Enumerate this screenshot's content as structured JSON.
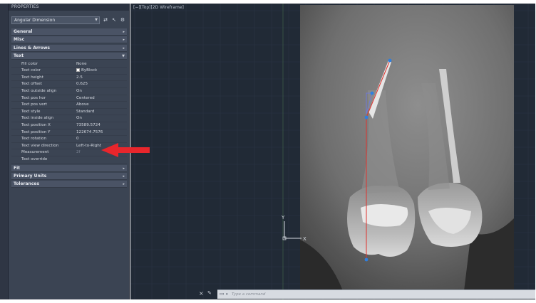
{
  "panel": {
    "title": "PROPERTIES",
    "object_type": "Angular Dimension",
    "sections_before": [
      {
        "label": "General"
      },
      {
        "label": "Misc"
      },
      {
        "label": "Lines & Arrows"
      }
    ],
    "text_section": {
      "label": "Text",
      "properties": [
        {
          "key": "Fill color",
          "value": "None"
        },
        {
          "key": "Text color",
          "value": "ByBlock"
        },
        {
          "key": "Text height",
          "value": "2.5"
        },
        {
          "key": "Text offset",
          "value": "0.625"
        },
        {
          "key": "Text outside align",
          "value": "On"
        },
        {
          "key": "Text pos hor",
          "value": "Centered"
        },
        {
          "key": "Text pos vert",
          "value": "Above"
        },
        {
          "key": "Text style",
          "value": "Standard"
        },
        {
          "key": "Text inside align",
          "value": "On"
        },
        {
          "key": "Text position X",
          "value": "73589.5724"
        },
        {
          "key": "Text position Y",
          "value": "122674.7576"
        },
        {
          "key": "Text rotation",
          "value": "0"
        },
        {
          "key": "Text view direction",
          "value": "Left-to-Right"
        },
        {
          "key": "Measurement",
          "value": "2f"
        },
        {
          "key": "Text override",
          "value": ""
        }
      ]
    },
    "sections_after": [
      {
        "label": "Fit"
      },
      {
        "label": "Primary Units"
      },
      {
        "label": "Tolerances"
      }
    ]
  },
  "viewport": {
    "label": "[−][Top][2D Wireframe]",
    "ucs_y": "Y",
    "ucs_x": "X",
    "command_placeholder": "Type a command"
  },
  "colors": {
    "annotation_arrow": "#e8262c",
    "dimension_line": "#e0332e",
    "grip": "#2f7fe0",
    "panel_bg": "#3b4453",
    "viewport_bg": "#212a36"
  }
}
